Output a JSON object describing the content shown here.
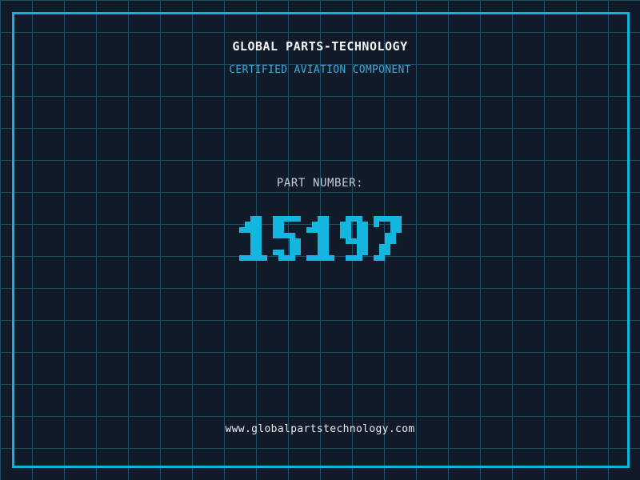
{
  "header": {
    "title": "GLOBAL PARTS-TECHNOLOGY",
    "subtitle": "CERTIFIED AVIATION COMPONENT"
  },
  "part": {
    "label": "PART NUMBER:",
    "number": "15197"
  },
  "footer": {
    "url": "www.globalpartstechnology.com"
  },
  "colors": {
    "background": "#101a29",
    "grid_line": "#1c4d62",
    "frame": "#0fb4dc",
    "title_text": "#f4f6f7",
    "subtitle_text": "#38abdb",
    "label_text": "#c8cdd5",
    "digits": "#12b6de",
    "url_text": "#eceeef"
  }
}
